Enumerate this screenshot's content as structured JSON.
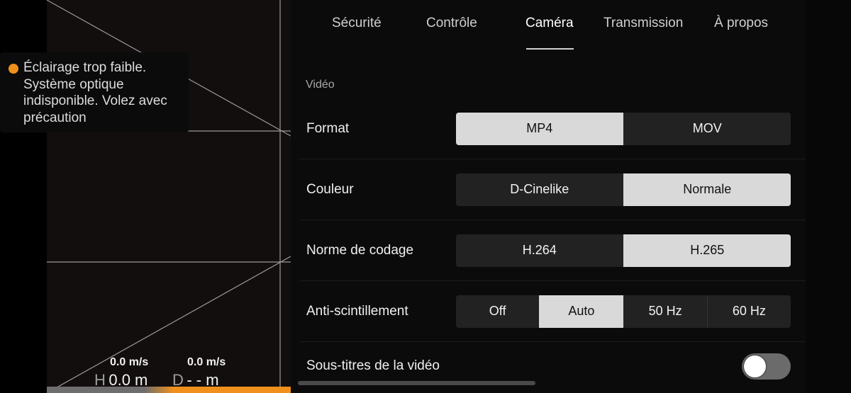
{
  "camera": {
    "warning": {
      "text": "Éclairage trop faible. Système optique indisponible. Volez avec précaution",
      "severity_color": "#f0901c"
    },
    "telemetry": {
      "horizontal_speed": "0.0 m/s",
      "vertical_speed": "0.0 m/s",
      "height_label": "H",
      "height_value": "0.0 m",
      "distance_label": "D",
      "distance_value": "- - m"
    },
    "battery_accent": "#f0901c"
  },
  "settings": {
    "tabs": [
      {
        "label": "Sécurité",
        "active": false
      },
      {
        "label": "Contrôle",
        "active": false
      },
      {
        "label": "Caméra",
        "active": true
      },
      {
        "label": "Transmission",
        "active": false
      },
      {
        "label": "À propos",
        "active": false
      }
    ],
    "section_title": "Vidéo",
    "rows": {
      "format": {
        "label": "Format",
        "options": [
          "MP4",
          "MOV"
        ],
        "selected": "MP4"
      },
      "color": {
        "label": "Couleur",
        "options": [
          "D-Cinelike",
          "Normale"
        ],
        "selected": "Normale"
      },
      "codec": {
        "label": "Norme de codage",
        "options": [
          "H.264",
          "H.265"
        ],
        "selected": "H.265"
      },
      "flicker": {
        "label": "Anti-scintillement",
        "options": [
          "Off",
          "Auto",
          "50 Hz",
          "60 Hz"
        ],
        "selected": "Auto"
      },
      "subtitles": {
        "label": "Sous-titres de la vidéo",
        "enabled": false
      }
    }
  }
}
